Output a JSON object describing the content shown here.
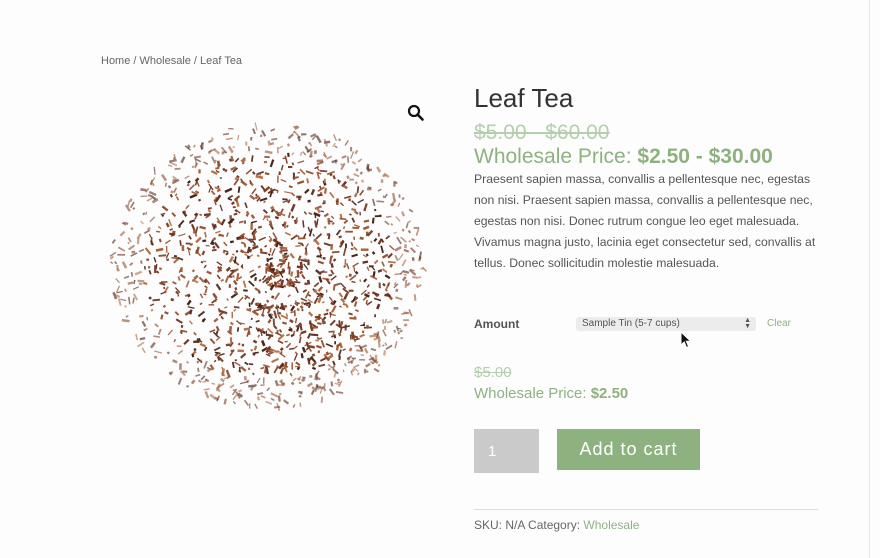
{
  "breadcrumb": {
    "home": "Home",
    "sep1": " / ",
    "wholesale": "Wholesale",
    "sep2": " / ",
    "current": "Leaf Tea"
  },
  "product": {
    "title": "Leaf Tea",
    "original_price_range": "$5.00 - $60.00",
    "wholesale_label": "Wholesale Price: ",
    "wholesale_price_range": "$2.50 - $30.00",
    "description": "Praesent sapien massa, convallis a pellentesque nec, egestas non nisi. Praesent sapien massa, convallis a pellentesque nec, egestas non nisi. Donec rutrum congue leo eget malesuada. Vivamus magna justo, lacinia eget consectetur sed, convallis at tellus. Donec sollicitudin molestie malesuada.",
    "image_icon": "loose-leaf-tea-pile-image",
    "zoom_icon": "magnifier-icon"
  },
  "variation": {
    "label": "Amount",
    "selected": "Sample Tin (5-7 cups)",
    "clear_label": "Clear",
    "original_price": "$5.00",
    "wholesale_label": "Wholesale Price: ",
    "wholesale_price": "$2.50"
  },
  "cart": {
    "quantity": "1",
    "add_label": "Add to cart"
  },
  "meta": {
    "sku_label": "SKU: ",
    "sku_value": "N/A",
    "category_label": " Category: ",
    "category_value": "Wholesale"
  },
  "colors": {
    "accent": "#8db27f",
    "accent_light": "#b4cfae",
    "quantity_bg": "#cacaca"
  }
}
